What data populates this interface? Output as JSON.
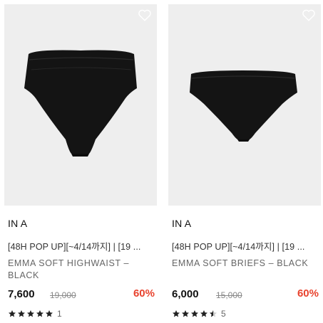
{
  "colors": {
    "image_bg": "#eeeeee",
    "discount": "#e8432e",
    "star": "#222222"
  },
  "products": [
    {
      "brand": "IN A",
      "promo": "[48H POP UP][~4/14까지] | [19 ...",
      "name": "EMMA SOFT HIGHWAIST – BLACK",
      "price": "7,600",
      "original_price": "19,000",
      "discount": "60%",
      "rating": 5,
      "review_count": "1",
      "favorite_icon": "heart-outline-icon"
    },
    {
      "brand": "IN A",
      "promo": "[48H POP UP][~4/14까지] | [19 ...",
      "name": "EMMA SOFT BRIEFS – BLACK",
      "price": "6,000",
      "original_price": "15,000",
      "discount": "60%",
      "rating": 4.5,
      "review_count": "5",
      "favorite_icon": "heart-outline-icon"
    }
  ]
}
